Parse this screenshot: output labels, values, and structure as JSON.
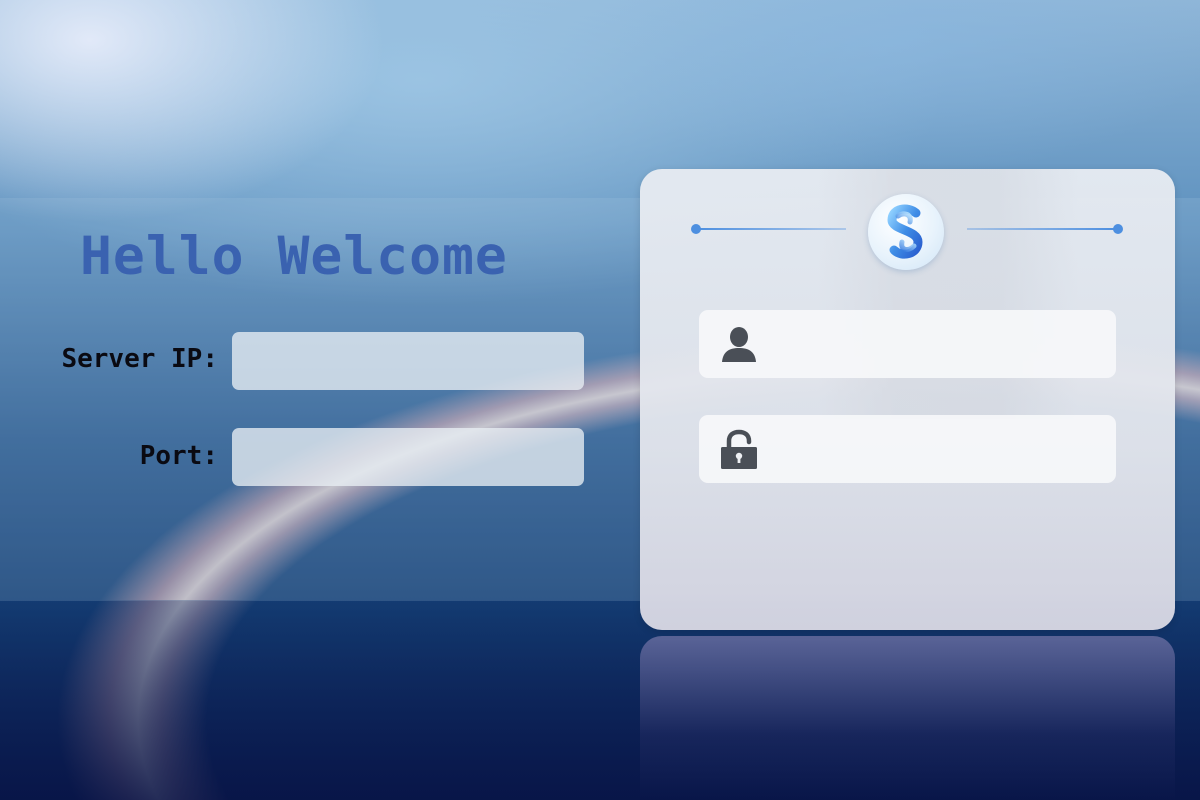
{
  "welcome": {
    "title": "Hello Welcome"
  },
  "server_form": {
    "server_ip_label": "Server IP:",
    "server_ip_value": "",
    "port_label": "Port:",
    "port_value": ""
  },
  "login_card": {
    "logo_icon": "s-logo-icon",
    "username_icon": "user-icon",
    "username_value": "",
    "password_icon": "lock-icon",
    "password_value": ""
  },
  "colors": {
    "title": "#3a62b0",
    "accent": "#4d8fe0",
    "icon": "#4a4f57"
  }
}
